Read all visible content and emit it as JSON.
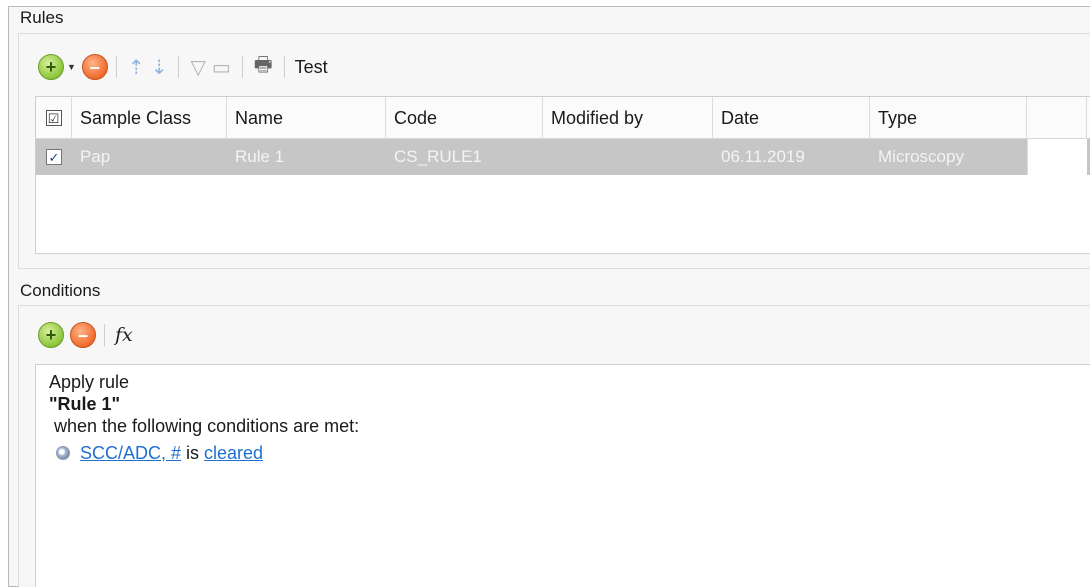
{
  "rules": {
    "title": "Rules",
    "toolbar": {
      "test_label": "Test"
    },
    "columns": [
      "Sample Class",
      "Name",
      "Code",
      "Modified by",
      "Date",
      "Type"
    ],
    "rows": [
      {
        "checked": "✓",
        "sample_class": "Pap",
        "name": "Rule 1",
        "code": "CS_RULE1",
        "modified_by": "",
        "date": "06.11.2019",
        "type": "Microscopy"
      }
    ],
    "header_check": "☑"
  },
  "conditions": {
    "title": "Conditions",
    "toolbar": {
      "fx_label": "fx"
    },
    "text": {
      "apply": "Apply rule",
      "rule_name": "\"Rule 1\"",
      "when": "when the following conditions are met:",
      "field_link": "SCC/ADC, #",
      "operator": "is",
      "value_link": "cleared"
    }
  },
  "colors": {
    "selection": "#c6c6c6",
    "link": "#1f6fd1",
    "add": "#8cc43a",
    "remove": "#f06a2b"
  },
  "icons": [
    "add-icon",
    "dropdown-caret-icon",
    "remove-icon",
    "move-up-icon",
    "move-down-icon",
    "filter-icon",
    "column-chooser-icon",
    "print-icon",
    "fx-icon"
  ]
}
